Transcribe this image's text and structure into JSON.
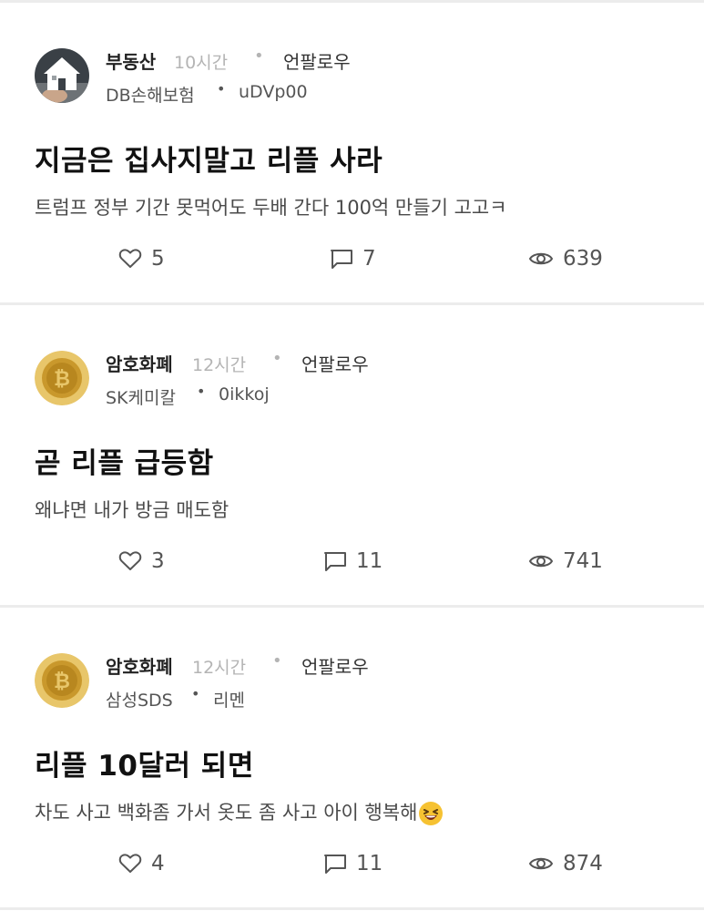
{
  "posts": [
    {
      "author": "부동산",
      "time": "10시간",
      "follow_label": "언팔로우",
      "company": "DB손해보험",
      "nickname": "uDVp00",
      "title": "지금은 집사지말고 리플 사라",
      "body": "트럼프 정부 기간 못먹어도 두배 간다 100억 만들기 고고ㅋ",
      "likes": "5",
      "comments": "7",
      "views": "639",
      "avatar_icon": "house-icon"
    },
    {
      "author": "암호화폐",
      "time": "12시간",
      "follow_label": "언팔로우",
      "company": "SK케미칼",
      "nickname": "0ikkoj",
      "title": "곧 리플 급등함",
      "body": "왜냐면  내가 방금 매도함",
      "likes": "3",
      "comments": "11",
      "views": "741",
      "avatar_icon": "bitcoin-coin-icon"
    },
    {
      "author": "암호화폐",
      "time": "12시간",
      "follow_label": "언팔로우",
      "company": "삼성SDS",
      "nickname": "리멘",
      "title": "리플 10달러 되면",
      "body": "차도 사고  백화좀 가서 옷도 좀 사고 아이 행복해",
      "body_emoji": "laughing-face-emoji",
      "likes": "4",
      "comments": "11",
      "views": "874",
      "avatar_icon": "bitcoin-coin-icon"
    }
  ],
  "colors": {
    "divider": "#ececec",
    "meta_gray": "#b4b4b4",
    "text_dark": "#111111",
    "coin_gold": "#e2b84a"
  }
}
